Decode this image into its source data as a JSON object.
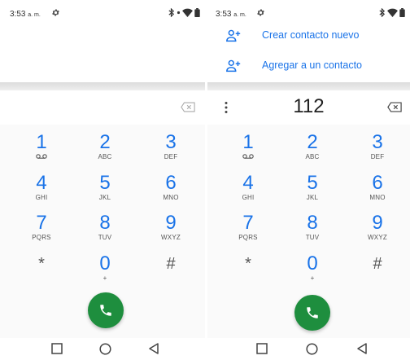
{
  "status": {
    "time": "3:53",
    "ampm": "a. m."
  },
  "colors": {
    "accent": "#1a73e8",
    "call_button": "#1e8e3e"
  },
  "icons": {
    "settings": "gear-icon",
    "bluetooth": "bluetooth-icon",
    "wifi": "wifi-icon",
    "battery": "battery-icon",
    "backspace": "backspace-icon",
    "more": "more-vert-icon",
    "add_contact": "person-add-icon",
    "voicemail": "voicemail-icon",
    "call": "phone-icon",
    "nav_recents": "square-icon",
    "nav_home": "circle-icon",
    "nav_back": "triangle-back-icon"
  },
  "left": {
    "dialed_number": ""
  },
  "right": {
    "suggestions": [
      {
        "label": "Crear contacto nuevo"
      },
      {
        "label": "Agregar a un contacto"
      }
    ],
    "dialed_number": "112"
  },
  "keypad": [
    {
      "digit": "1",
      "letters": ""
    },
    {
      "digit": "2",
      "letters": "ABC"
    },
    {
      "digit": "3",
      "letters": "DEF"
    },
    {
      "digit": "4",
      "letters": "GHI"
    },
    {
      "digit": "5",
      "letters": "JKL"
    },
    {
      "digit": "6",
      "letters": "MNO"
    },
    {
      "digit": "7",
      "letters": "PQRS"
    },
    {
      "digit": "8",
      "letters": "TUV"
    },
    {
      "digit": "9",
      "letters": "WXYZ"
    },
    {
      "digit": "*",
      "letters": ""
    },
    {
      "digit": "0",
      "letters": "+"
    },
    {
      "digit": "#",
      "letters": ""
    }
  ]
}
